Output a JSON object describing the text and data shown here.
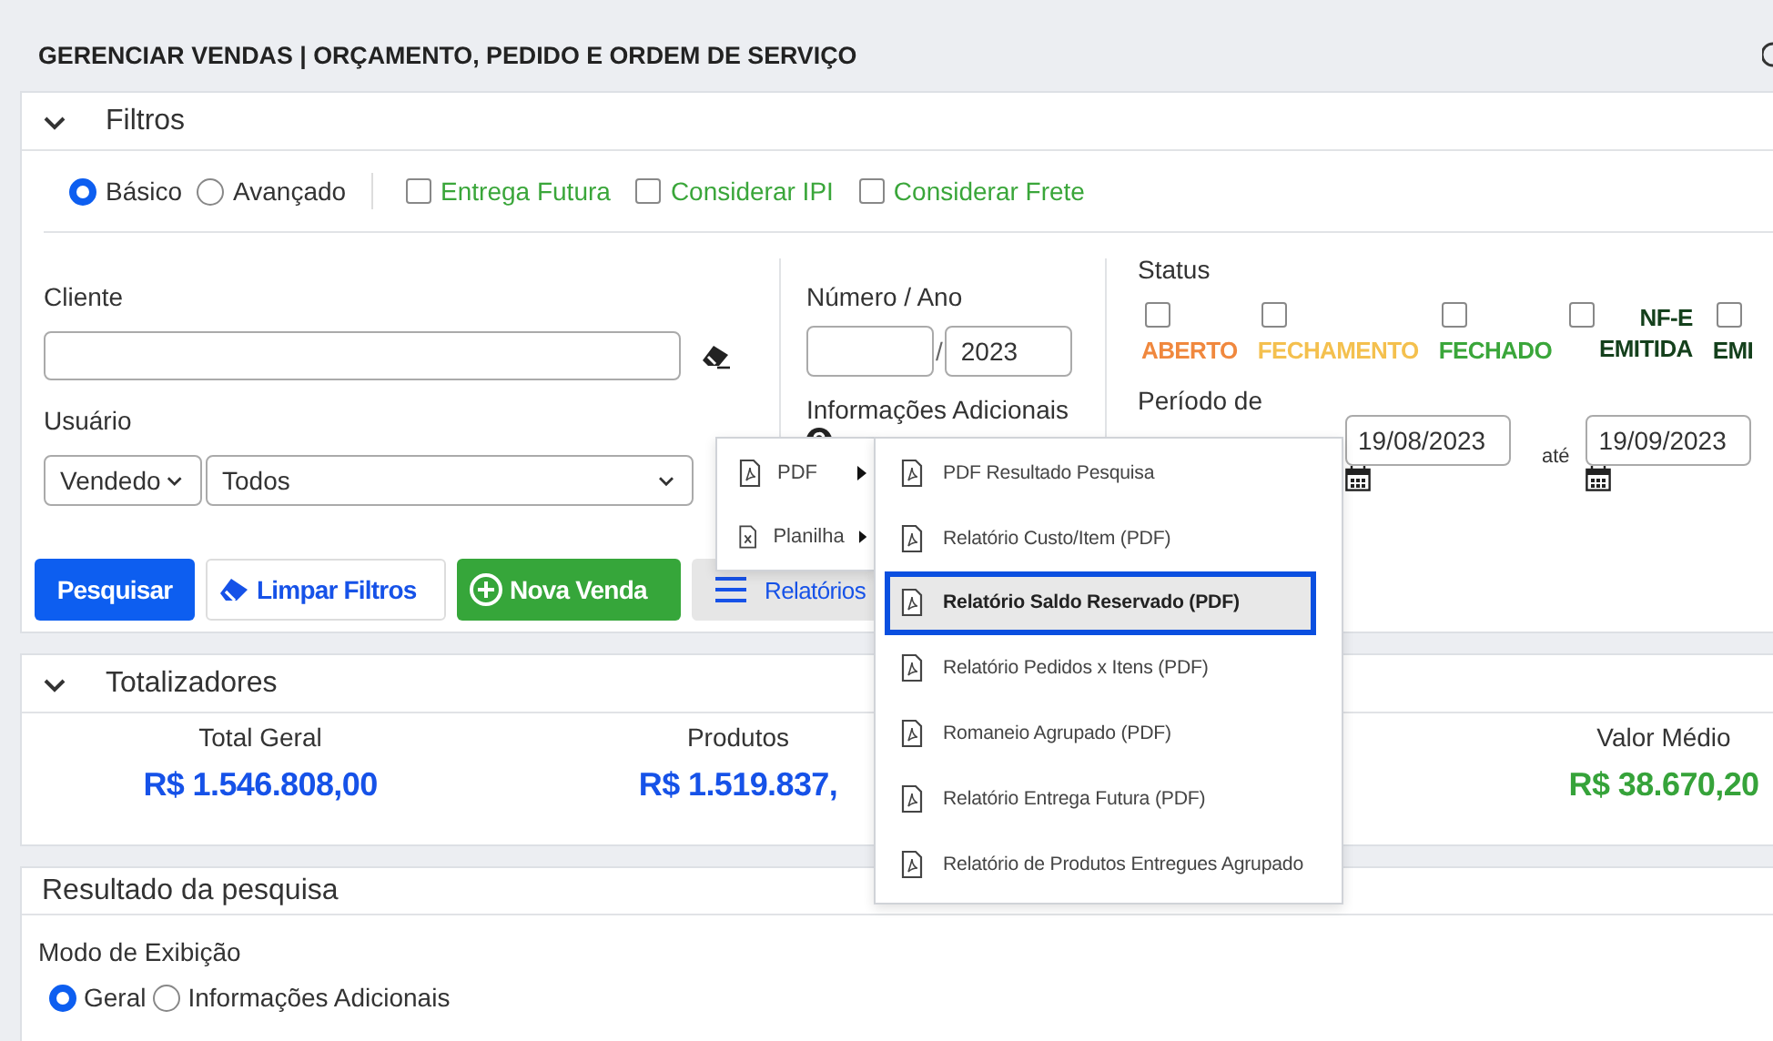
{
  "header": {
    "title": "GERENCIAR VENDAS | ORÇAMENTO, PEDIDO E ORDEM DE SERVIÇO"
  },
  "filters": {
    "title": "Filtros",
    "expanded": true,
    "modes": [
      {
        "label": "Básico",
        "selected": true
      },
      {
        "label": "Avançado",
        "selected": false
      }
    ],
    "options": [
      {
        "label": "Entrega Futura",
        "checked": false
      },
      {
        "label": "Considerar IPI",
        "checked": false
      },
      {
        "label": "Considerar Frete",
        "checked": false
      }
    ],
    "cliente": {
      "label": "Cliente"
    },
    "usuario": {
      "label": "Usuário",
      "type": "Vendedo",
      "value": "Todos"
    },
    "numero": {
      "label": "Número / Ano",
      "separator": "/",
      "year": "2023"
    },
    "info": {
      "label": "Informações Adicionais"
    },
    "status": {
      "label": "Status",
      "items": [
        {
          "label": "ABERTO",
          "checked": false,
          "color": "#f0883e",
          "kind": "stacked"
        },
        {
          "label": "FECHAMENTO",
          "checked": false,
          "color": "#f4c04e",
          "kind": "stacked"
        },
        {
          "label": "FECHADO",
          "checked": false,
          "color": "#3aa63a",
          "kind": "stacked"
        },
        {
          "label": "NF-E EMITIDA",
          "checked": false,
          "color": "#14401c",
          "kind": "inline"
        },
        {
          "label": "EMI",
          "checked": false,
          "color": "#14401c",
          "kind": "stacked"
        }
      ]
    },
    "periodo": {
      "label": "Período de",
      "from": "19/08/2023",
      "to_label": "até",
      "to": "19/09/2023"
    },
    "buttons": [
      {
        "label": "Pesquisar",
        "kind": "primary"
      },
      {
        "label": "Limpar Filtros",
        "kind": "clear"
      },
      {
        "label": "Nova Venda",
        "kind": "new"
      },
      {
        "label": "Relatórios",
        "kind": "menu"
      }
    ]
  },
  "menu": {
    "items": [
      {
        "label": "PDF",
        "kind": "pdf"
      },
      {
        "label": "Planilha",
        "kind": "sheet"
      }
    ],
    "submenu": [
      {
        "label": "PDF Resultado Pesquisa",
        "selected": false
      },
      {
        "label": "Relatório Custo/Item (PDF)",
        "selected": false
      },
      {
        "label": "Relatório Saldo Reservado (PDF)",
        "selected": true
      },
      {
        "label": "Relatório Pedidos x Itens (PDF)",
        "selected": false
      },
      {
        "label": "Romaneio Agrupado (PDF)",
        "selected": false
      },
      {
        "label": "Relatório Entrega Futura (PDF)",
        "selected": false
      },
      {
        "label": "Relatório de Produtos Entregues Agrupado",
        "selected": false
      }
    ]
  },
  "totals": {
    "title": "Totalizadores",
    "expanded": true,
    "items": [
      {
        "label": "Total Geral",
        "value": "R$ 1.546.808,00",
        "color": "#1652e8"
      },
      {
        "label": "Produtos",
        "value": "R$ 1.519.837,",
        "color": "#1652e8"
      },
      {
        "label": "Valor Médio",
        "value": "R$ 38.670,20",
        "color": "#36a33a"
      }
    ]
  },
  "results": {
    "title": "Resultado da pesquisa",
    "mode_label": "Modo de Exibição",
    "modes": [
      {
        "label": "Geral",
        "selected": true
      },
      {
        "label": "Informações Adicionais",
        "selected": false
      }
    ]
  }
}
